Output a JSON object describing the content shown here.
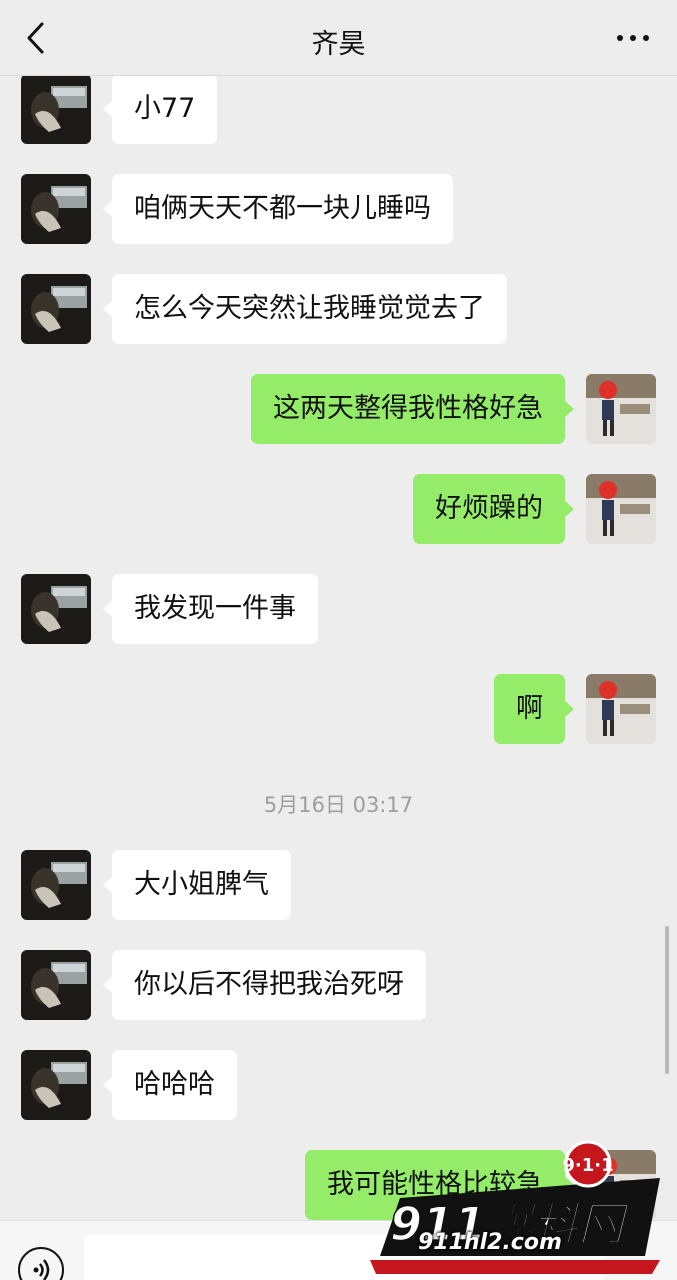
{
  "header": {
    "title": "齐昊"
  },
  "messages": [
    {
      "side": "in",
      "text": "小77"
    },
    {
      "side": "in",
      "text": "咱俩天天不都一块儿睡吗"
    },
    {
      "side": "in",
      "text": "怎么今天突然让我睡觉觉去了"
    },
    {
      "side": "out",
      "text": "这两天整得我性格好急"
    },
    {
      "side": "out",
      "text": "好烦躁的"
    },
    {
      "side": "in",
      "text": "我发现一件事"
    },
    {
      "side": "out",
      "text": "啊"
    },
    {
      "side": "in",
      "text": "大小姐脾气"
    },
    {
      "side": "in",
      "text": "你以后不得把我治死呀"
    },
    {
      "side": "in",
      "text": "哈哈哈"
    },
    {
      "side": "out",
      "text": "我可能性格比较急"
    }
  ],
  "timestamp": "5月16日 03:17",
  "watermark": {
    "logo": "911爆料网",
    "badge": "9·1·1",
    "site": "911hl2.com"
  },
  "colors": {
    "background": "#ededed",
    "outgoing_bubble": "#95ec69",
    "incoming_bubble": "#ffffff"
  },
  "icons": {
    "back": "chevron-left-icon",
    "more": "more-dots-icon",
    "voice": "voice-icon"
  }
}
